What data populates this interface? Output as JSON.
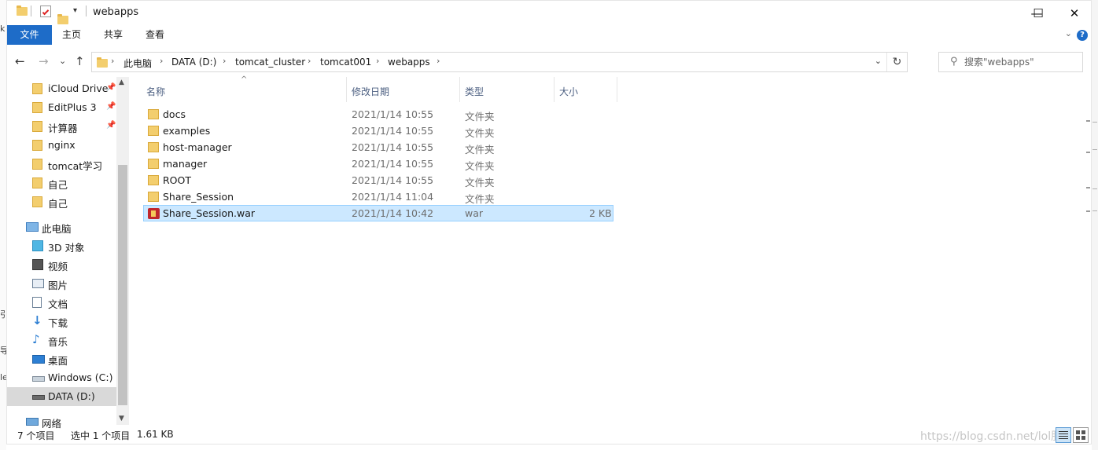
{
  "window": {
    "title": "webapps"
  },
  "titlebar": {
    "minimize_glyph": "—",
    "maximize_glyph": "☐",
    "close_glyph": "✕"
  },
  "ribbon": {
    "tabs": [
      {
        "label": "文件",
        "active": true
      },
      {
        "label": "主页",
        "active": false
      },
      {
        "label": "共享",
        "active": false
      },
      {
        "label": "查看",
        "active": false
      }
    ],
    "help_glyph": "?",
    "expand_glyph": "⌄"
  },
  "nav": {
    "back_glyph": "←",
    "forward_glyph": "→",
    "recent_glyph": "⌄",
    "up_glyph": "↑",
    "breadcrumb": [
      "此电脑",
      "DATA (D:)",
      "tomcat_cluster",
      "tomcat001",
      "webapps"
    ],
    "separator": "›",
    "refresh_glyph": "↻",
    "search_placeholder": "搜索\"webapps\"",
    "search_glyph": "⚲"
  },
  "sidebar": {
    "quick_access": [
      {
        "label": "iCloud Drive",
        "pinned": true
      },
      {
        "label": "EditPlus 3",
        "pinned": true
      },
      {
        "label": "计算器",
        "pinned": true
      },
      {
        "label": "nginx",
        "pinned": false
      },
      {
        "label": "tomcat学习",
        "pinned": false
      },
      {
        "label": "自己",
        "pinned": false
      },
      {
        "label": "自己",
        "pinned": false
      }
    ],
    "pin_glyph": "📌",
    "this_pc": "此电脑",
    "pc_items": [
      {
        "label": "3D 对象",
        "icon": "cube-icon"
      },
      {
        "label": "视频",
        "icon": "video-icon"
      },
      {
        "label": "图片",
        "icon": "picture-icon"
      },
      {
        "label": "文档",
        "icon": "document-icon"
      },
      {
        "label": "下载",
        "icon": "download-icon"
      },
      {
        "label": "音乐",
        "icon": "music-icon"
      },
      {
        "label": "桌面",
        "icon": "desktop-icon"
      },
      {
        "label": "Windows (C:)",
        "icon": "drive-icon"
      },
      {
        "label": "DATA (D:)",
        "icon": "drive-icon",
        "selected": true
      }
    ],
    "network": "网络",
    "scroll_up_glyph": "▲",
    "scroll_down_glyph": "▼"
  },
  "list": {
    "columns": {
      "name": "名称",
      "date": "修改日期",
      "type": "类型",
      "size": "大小"
    },
    "sort_glyph": "^",
    "rows": [
      {
        "name": "docs",
        "date": "2021/1/14 10:55",
        "type": "文件夹",
        "size": "",
        "icon": "folder-icon"
      },
      {
        "name": "examples",
        "date": "2021/1/14 10:55",
        "type": "文件夹",
        "size": "",
        "icon": "folder-icon"
      },
      {
        "name": "host-manager",
        "date": "2021/1/14 10:55",
        "type": "文件夹",
        "size": "",
        "icon": "folder-icon"
      },
      {
        "name": "manager",
        "date": "2021/1/14 10:55",
        "type": "文件夹",
        "size": "",
        "icon": "folder-icon"
      },
      {
        "name": "ROOT",
        "date": "2021/1/14 10:55",
        "type": "文件夹",
        "size": "",
        "icon": "folder-icon"
      },
      {
        "name": "Share_Session",
        "date": "2021/1/14 11:04",
        "type": "文件夹",
        "size": "",
        "icon": "folder-icon"
      },
      {
        "name": "Share_Session.war",
        "date": "2021/1/14 10:42",
        "type": "war",
        "size": "2 KB",
        "icon": "war-file-icon",
        "selected": true
      }
    ]
  },
  "status": {
    "item_count": "7 个项目",
    "selection": "选中 1 个项目",
    "selection_size": "1.61 KB"
  },
  "watermark": "https://blog.csdn.net/lol胆",
  "background_fragments": [
    "k",
    "引",
    "导",
    "le"
  ],
  "colors": {
    "accent": "#1e6cc8",
    "selection": "#cce8ff",
    "folder": "#f3ce6e"
  }
}
